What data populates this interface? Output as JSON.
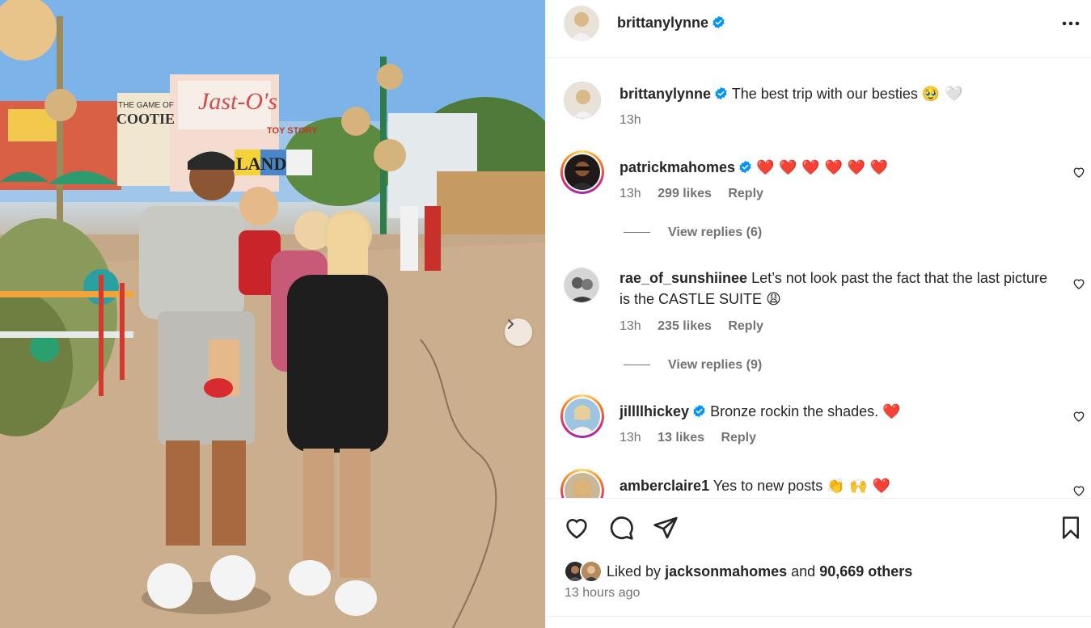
{
  "post": {
    "author": "brittanylynne",
    "verified": true,
    "more_icon": "more-horizontal-icon"
  },
  "caption": {
    "username": "brittanylynne",
    "text": "The best trip with our besties",
    "emoji": "🥹 🤍",
    "time": "13h"
  },
  "photo": {
    "signs": [
      "Jast-O's",
      "THE GAME OF",
      "COOTIE",
      "TOY STORY",
      "LAND"
    ],
    "next_icon": "chevron-right-icon"
  },
  "comments": [
    {
      "username": "patrickmahomes",
      "verified": true,
      "text": "",
      "emoji": "❤️ ❤️ ❤️ ❤️ ❤️ ❤️",
      "time": "13h",
      "likes": "299 likes",
      "reply": "Reply",
      "view_replies": "View replies (6)"
    },
    {
      "username": "rae_of_sunshiinee",
      "verified": false,
      "text": "Let’s not look past the fact that the last picture is the CASTLE SUITE",
      "emoji": "😩",
      "time": "13h",
      "likes": "235 likes",
      "reply": "Reply",
      "view_replies": "View replies (9)"
    },
    {
      "username": "jillllhickey",
      "verified": true,
      "text": "Bronze rockin the shades.",
      "emoji": "❤️",
      "time": "13h",
      "likes": "13 likes",
      "reply": "Reply"
    },
    {
      "username": "amberclaire1",
      "verified": false,
      "text": "Yes to new posts",
      "emoji": "👏 🙌 ❤️"
    }
  ],
  "actions": {
    "like_icon": "heart-icon",
    "comment_icon": "comment-icon",
    "share_icon": "share-icon",
    "save_icon": "bookmark-icon"
  },
  "likes": {
    "prefix": "Liked by",
    "user": "jacksonmahomes",
    "connector": "and",
    "others": "90,669 others",
    "time_ago": "13 hours ago"
  },
  "colors": {
    "verified": "#0095f6",
    "heart": "#ed4956",
    "muted": "#737373",
    "text": "#262626"
  }
}
